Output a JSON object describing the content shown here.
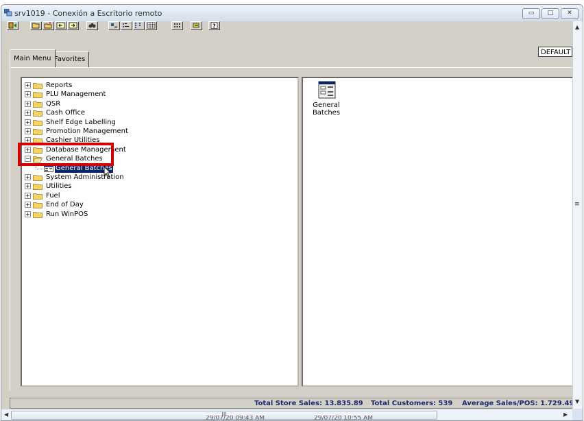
{
  "window": {
    "title": "srv1019 - Conexión a Escritorio remoto",
    "minimize_glyph": "▭",
    "maximize_glyph": "□",
    "close_glyph": "✕"
  },
  "toolbar": {
    "buttons": [
      "exit-icon",
      "open-icon",
      "new-folder-icon",
      "back-icon",
      "forward-icon",
      "find-icon",
      "large-icons-icon",
      "small-icons-icon",
      "list-view-icon",
      "details-view-icon",
      "grid-icon",
      "tools-icon",
      "help-icon"
    ]
  },
  "tabs": {
    "main_menu": "Main Menu",
    "favorites": "Favorites"
  },
  "profile": {
    "value": "DEFAULT"
  },
  "tree": {
    "items": [
      {
        "label": "Reports",
        "expander": "+"
      },
      {
        "label": "PLU Management",
        "expander": "+"
      },
      {
        "label": "QSR",
        "expander": "+"
      },
      {
        "label": "Cash Office",
        "expander": "+"
      },
      {
        "label": "Shelf Edge Labelling",
        "expander": "+"
      },
      {
        "label": "Promotion Management",
        "expander": "+"
      },
      {
        "label": "Cashier Utilities",
        "expander": "+"
      },
      {
        "label": "Database Management",
        "expander": "+"
      },
      {
        "label": "General Batches",
        "expander": "−"
      },
      {
        "label": "General Batches",
        "child": true,
        "selected": true
      },
      {
        "label": "System Administration",
        "expander": "+"
      },
      {
        "label": "Utilities",
        "expander": "+"
      },
      {
        "label": "Fuel",
        "expander": "+"
      },
      {
        "label": "End of Day",
        "expander": "+"
      },
      {
        "label": "Run WinPOS",
        "expander": "+"
      }
    ]
  },
  "view": {
    "item_label_line1": "General",
    "item_label_line2": "Batches"
  },
  "status": {
    "total_store_sales": "Total Store Sales: 13.835.89",
    "total_customers": "Total Customers: 539",
    "average_sales": "Average Sales/POS: 1.729.49"
  },
  "scroll": {
    "thumb_grip": "III"
  },
  "background": {
    "timestamp_left": "29/07/20 09:43 AM",
    "timestamp_right": "29/07/20 10:55 AM"
  },
  "colors": {
    "selection": "#0a246a",
    "highlight_border": "#d20000",
    "status_text": "#1a2a6a"
  }
}
